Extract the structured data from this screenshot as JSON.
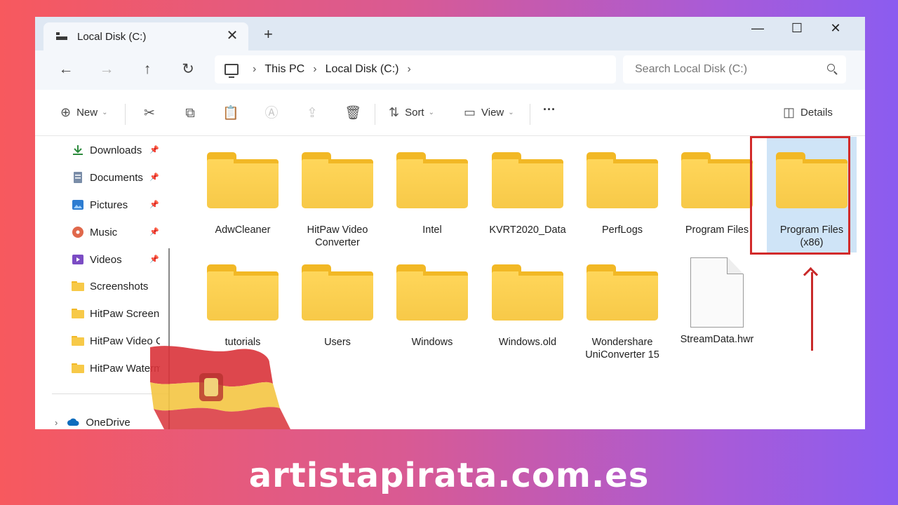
{
  "window": {
    "tab_title": "Local Disk (C:)",
    "close_tab": "✕",
    "new_tab": "+",
    "minimize": "—",
    "maximize": "☐",
    "close": "✕"
  },
  "address": {
    "back": "←",
    "forward": "→",
    "up": "↑",
    "refresh": "↻",
    "breadcrumbs": [
      "This PC",
      "Local Disk (C:)"
    ],
    "search_placeholder": "Search Local Disk (C:)"
  },
  "toolbar": {
    "new_label": "New",
    "sort_label": "Sort",
    "view_label": "View",
    "more_label": "···",
    "details_label": "Details",
    "icons": [
      "cut-icon",
      "copy-icon",
      "paste-icon",
      "rename-icon",
      "share-icon",
      "delete-icon"
    ]
  },
  "sidebar": {
    "items": [
      {
        "label": "Downloads",
        "icon": "download-icon",
        "pinned": true
      },
      {
        "label": "Documents",
        "icon": "documents-icon",
        "pinned": true
      },
      {
        "label": "Pictures",
        "icon": "pictures-icon",
        "pinned": true
      },
      {
        "label": "Music",
        "icon": "music-icon",
        "pinned": true
      },
      {
        "label": "Videos",
        "icon": "videos-icon",
        "pinned": true
      },
      {
        "label": "Screenshots",
        "icon": "folder-icon",
        "pinned": false
      },
      {
        "label": "HitPaw Screen R",
        "icon": "folder-icon",
        "pinned": false
      },
      {
        "label": "HitPaw Video Co",
        "icon": "folder-icon",
        "pinned": false
      },
      {
        "label": "HitPaw Waterm",
        "icon": "folder-icon",
        "pinned": false
      }
    ],
    "onedrive_label": "OneDrive"
  },
  "files": [
    {
      "name": "AdwCleaner",
      "type": "folder"
    },
    {
      "name": "HitPaw Video\nConverter",
      "type": "folder"
    },
    {
      "name": "Intel",
      "type": "folder"
    },
    {
      "name": "KVRT2020_Data",
      "type": "folder"
    },
    {
      "name": "PerfLogs",
      "type": "folder"
    },
    {
      "name": "Program Files",
      "type": "folder"
    },
    {
      "name": "Program Files\n(x86)",
      "type": "folder",
      "selected": true
    },
    {
      "name": "tutorials",
      "type": "folder"
    },
    {
      "name": "Users",
      "type": "folder"
    },
    {
      "name": "Windows",
      "type": "folder"
    },
    {
      "name": "Windows.old",
      "type": "folder"
    },
    {
      "name": "Wondershare\nUniConverter 15",
      "type": "folder"
    },
    {
      "name": "StreamData.hwr",
      "type": "file"
    }
  ],
  "watermark": "artistapirata.com.es",
  "colors": {
    "highlight": "#d22a2a",
    "folder": "#f7c948",
    "selection": "#cfe4f7"
  }
}
